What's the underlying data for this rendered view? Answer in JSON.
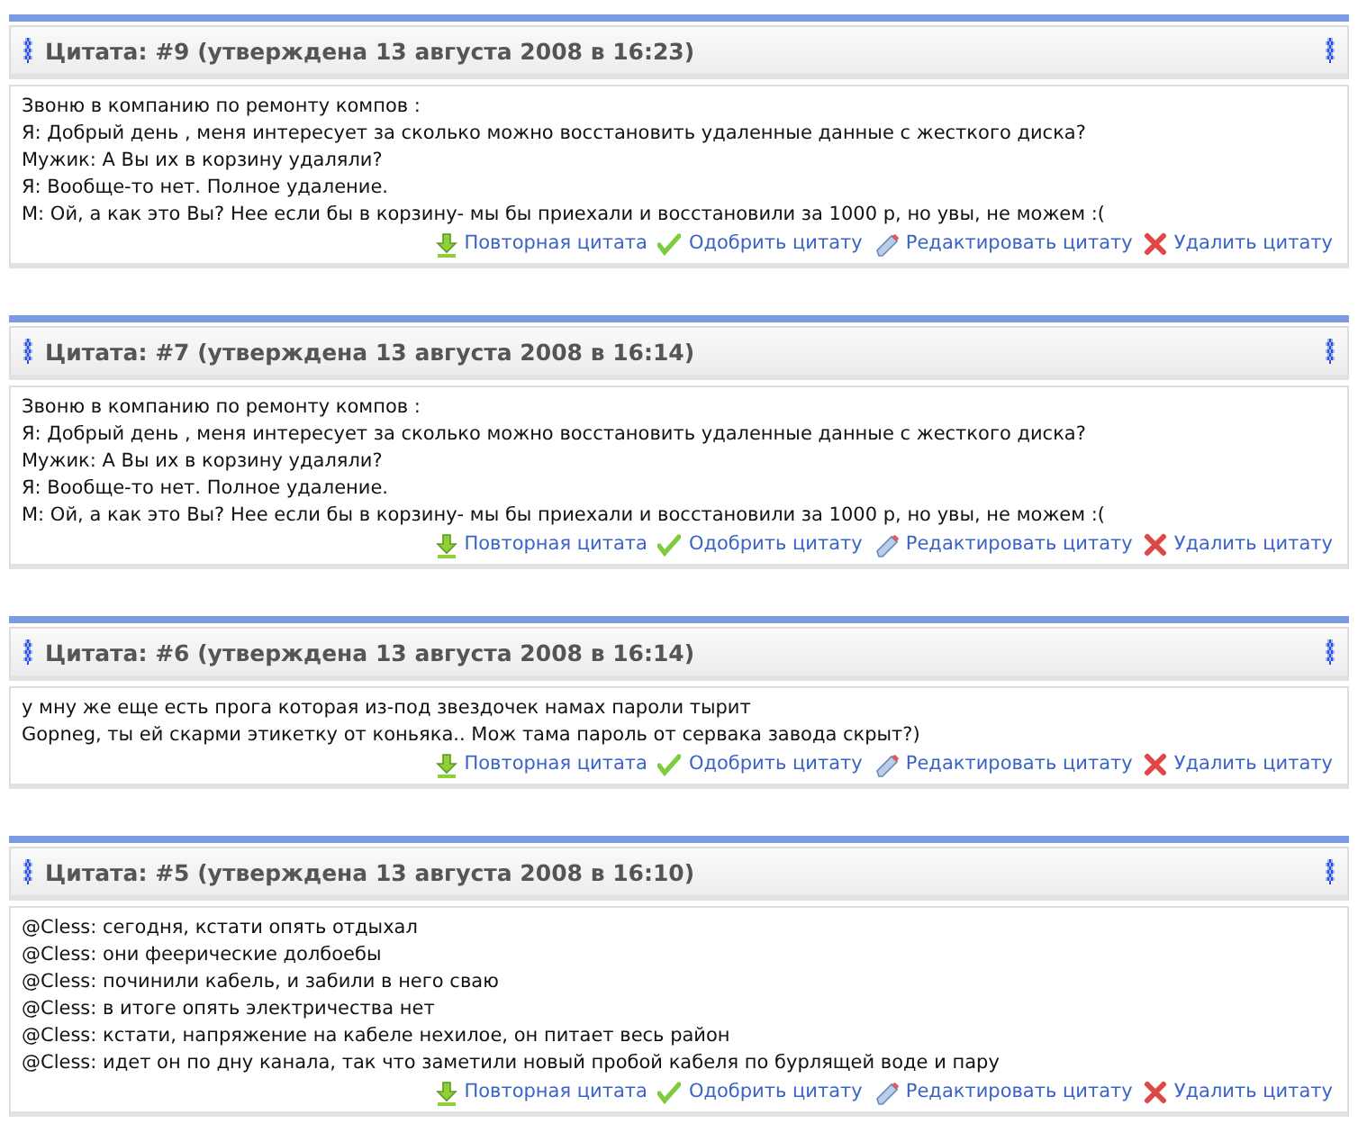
{
  "quotes": [
    {
      "title": "Цитата: #9 (утверждена 13 августа 2008 в 16:23)",
      "lines": [
        "Звоню в компанию по ремонту компов :",
        "Я: Добрый день , меня интересует за сколько можно восстановить удаленные данные с жесткого диска?",
        "Мужик: А Вы их в корзину удаляли?",
        "Я: Вообще-то нет. Полное удаление.",
        "М: Ой, а как это Вы? Нее если бы в корзину- мы бы приехали и восстановили за 1000 р, но увы, не можем :("
      ],
      "actions": [
        {
          "kind": "repeat",
          "label": "Повторная цитата"
        },
        {
          "kind": "approve",
          "label": "Одобрить цитату"
        },
        {
          "kind": "edit",
          "label": "Редактировать цитату"
        },
        {
          "kind": "delete",
          "label": "Удалить цитату"
        }
      ]
    },
    {
      "title": "Цитата: #7 (утверждена 13 августа 2008 в 16:14)",
      "lines": [
        "Звоню в компанию по ремонту компов :",
        "Я: Добрый день , меня интересует за сколько можно восстановить удаленные данные с жесткого диска?",
        "Мужик: А Вы их в корзину удаляли?",
        "Я: Вообще-то нет. Полное удаление.",
        "М: Ой, а как это Вы? Нее если бы в корзину- мы бы приехали и восстановили за 1000 р, но увы, не можем :("
      ],
      "actions": [
        {
          "kind": "repeat",
          "label": "Повторная цитата"
        },
        {
          "kind": "approve",
          "label": "Одобрить цитату"
        },
        {
          "kind": "edit",
          "label": "Редактировать цитату"
        },
        {
          "kind": "delete",
          "label": "Удалить цитату"
        }
      ]
    },
    {
      "title": "Цитата: #6 (утверждена 13 августа 2008 в 16:14)",
      "lines": [
        "у мну же еще есть прога которая из-под звездочек намах пароли тырит",
        "Gopneg, ты ей скарми этикетку от коньяка.. Мож тама пароль от сервака завода скрыт?)"
      ],
      "actions": [
        {
          "kind": "repeat",
          "label": "Повторная цитата"
        },
        {
          "kind": "approve",
          "label": "Одобрить цитату"
        },
        {
          "kind": "edit",
          "label": "Редактировать цитату"
        },
        {
          "kind": "delete",
          "label": "Удалить цитату"
        }
      ]
    },
    {
      "title": "Цитата: #5 (утверждена 13 августа 2008 в 16:10)",
      "lines": [
        "@Cless: сегодня, кстати опять отдыхал",
        "@Cless: они феерические долбоебы",
        "@Cless: починили кабель, и забили в него сваю",
        "@Cless: в итоге опять электричества нет",
        "@Cless: кстати, напряжение на кабеле нехилое, он питает весь район",
        "@Cless: идет он по дну канала, так что заметили новый пробой кабеля по бурлящей воде и пару"
      ],
      "actions": [
        {
          "kind": "repeat",
          "label": "Повторная цитата"
        },
        {
          "kind": "approve",
          "label": "Одобрить цитату"
        },
        {
          "kind": "edit",
          "label": "Редактировать цитату"
        },
        {
          "kind": "delete",
          "label": "Удалить цитату"
        }
      ]
    }
  ]
}
